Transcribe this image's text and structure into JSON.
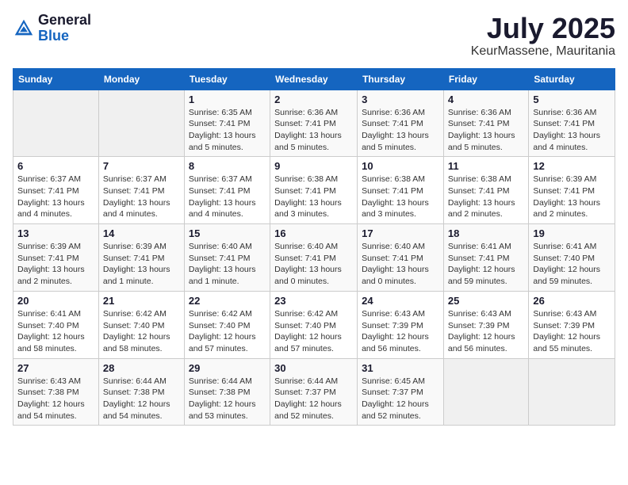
{
  "logo": {
    "general": "General",
    "blue": "Blue"
  },
  "header": {
    "month": "July 2025",
    "location": "KeurMassene, Mauritania"
  },
  "weekdays": [
    "Sunday",
    "Monday",
    "Tuesday",
    "Wednesday",
    "Thursday",
    "Friday",
    "Saturday"
  ],
  "weeks": [
    [
      {
        "day": "",
        "sunrise": "",
        "sunset": "",
        "daylight": ""
      },
      {
        "day": "",
        "sunrise": "",
        "sunset": "",
        "daylight": ""
      },
      {
        "day": "1",
        "sunrise": "Sunrise: 6:35 AM",
        "sunset": "Sunset: 7:41 PM",
        "daylight": "Daylight: 13 hours and 5 minutes."
      },
      {
        "day": "2",
        "sunrise": "Sunrise: 6:36 AM",
        "sunset": "Sunset: 7:41 PM",
        "daylight": "Daylight: 13 hours and 5 minutes."
      },
      {
        "day": "3",
        "sunrise": "Sunrise: 6:36 AM",
        "sunset": "Sunset: 7:41 PM",
        "daylight": "Daylight: 13 hours and 5 minutes."
      },
      {
        "day": "4",
        "sunrise": "Sunrise: 6:36 AM",
        "sunset": "Sunset: 7:41 PM",
        "daylight": "Daylight: 13 hours and 5 minutes."
      },
      {
        "day": "5",
        "sunrise": "Sunrise: 6:36 AM",
        "sunset": "Sunset: 7:41 PM",
        "daylight": "Daylight: 13 hours and 4 minutes."
      }
    ],
    [
      {
        "day": "6",
        "sunrise": "Sunrise: 6:37 AM",
        "sunset": "Sunset: 7:41 PM",
        "daylight": "Daylight: 13 hours and 4 minutes."
      },
      {
        "day": "7",
        "sunrise": "Sunrise: 6:37 AM",
        "sunset": "Sunset: 7:41 PM",
        "daylight": "Daylight: 13 hours and 4 minutes."
      },
      {
        "day": "8",
        "sunrise": "Sunrise: 6:37 AM",
        "sunset": "Sunset: 7:41 PM",
        "daylight": "Daylight: 13 hours and 4 minutes."
      },
      {
        "day": "9",
        "sunrise": "Sunrise: 6:38 AM",
        "sunset": "Sunset: 7:41 PM",
        "daylight": "Daylight: 13 hours and 3 minutes."
      },
      {
        "day": "10",
        "sunrise": "Sunrise: 6:38 AM",
        "sunset": "Sunset: 7:41 PM",
        "daylight": "Daylight: 13 hours and 3 minutes."
      },
      {
        "day": "11",
        "sunrise": "Sunrise: 6:38 AM",
        "sunset": "Sunset: 7:41 PM",
        "daylight": "Daylight: 13 hours and 2 minutes."
      },
      {
        "day": "12",
        "sunrise": "Sunrise: 6:39 AM",
        "sunset": "Sunset: 7:41 PM",
        "daylight": "Daylight: 13 hours and 2 minutes."
      }
    ],
    [
      {
        "day": "13",
        "sunrise": "Sunrise: 6:39 AM",
        "sunset": "Sunset: 7:41 PM",
        "daylight": "Daylight: 13 hours and 2 minutes."
      },
      {
        "day": "14",
        "sunrise": "Sunrise: 6:39 AM",
        "sunset": "Sunset: 7:41 PM",
        "daylight": "Daylight: 13 hours and 1 minute."
      },
      {
        "day": "15",
        "sunrise": "Sunrise: 6:40 AM",
        "sunset": "Sunset: 7:41 PM",
        "daylight": "Daylight: 13 hours and 1 minute."
      },
      {
        "day": "16",
        "sunrise": "Sunrise: 6:40 AM",
        "sunset": "Sunset: 7:41 PM",
        "daylight": "Daylight: 13 hours and 0 minutes."
      },
      {
        "day": "17",
        "sunrise": "Sunrise: 6:40 AM",
        "sunset": "Sunset: 7:41 PM",
        "daylight": "Daylight: 13 hours and 0 minutes."
      },
      {
        "day": "18",
        "sunrise": "Sunrise: 6:41 AM",
        "sunset": "Sunset: 7:41 PM",
        "daylight": "Daylight: 12 hours and 59 minutes."
      },
      {
        "day": "19",
        "sunrise": "Sunrise: 6:41 AM",
        "sunset": "Sunset: 7:40 PM",
        "daylight": "Daylight: 12 hours and 59 minutes."
      }
    ],
    [
      {
        "day": "20",
        "sunrise": "Sunrise: 6:41 AM",
        "sunset": "Sunset: 7:40 PM",
        "daylight": "Daylight: 12 hours and 58 minutes."
      },
      {
        "day": "21",
        "sunrise": "Sunrise: 6:42 AM",
        "sunset": "Sunset: 7:40 PM",
        "daylight": "Daylight: 12 hours and 58 minutes."
      },
      {
        "day": "22",
        "sunrise": "Sunrise: 6:42 AM",
        "sunset": "Sunset: 7:40 PM",
        "daylight": "Daylight: 12 hours and 57 minutes."
      },
      {
        "day": "23",
        "sunrise": "Sunrise: 6:42 AM",
        "sunset": "Sunset: 7:40 PM",
        "daylight": "Daylight: 12 hours and 57 minutes."
      },
      {
        "day": "24",
        "sunrise": "Sunrise: 6:43 AM",
        "sunset": "Sunset: 7:39 PM",
        "daylight": "Daylight: 12 hours and 56 minutes."
      },
      {
        "day": "25",
        "sunrise": "Sunrise: 6:43 AM",
        "sunset": "Sunset: 7:39 PM",
        "daylight": "Daylight: 12 hours and 56 minutes."
      },
      {
        "day": "26",
        "sunrise": "Sunrise: 6:43 AM",
        "sunset": "Sunset: 7:39 PM",
        "daylight": "Daylight: 12 hours and 55 minutes."
      }
    ],
    [
      {
        "day": "27",
        "sunrise": "Sunrise: 6:43 AM",
        "sunset": "Sunset: 7:38 PM",
        "daylight": "Daylight: 12 hours and 54 minutes."
      },
      {
        "day": "28",
        "sunrise": "Sunrise: 6:44 AM",
        "sunset": "Sunset: 7:38 PM",
        "daylight": "Daylight: 12 hours and 54 minutes."
      },
      {
        "day": "29",
        "sunrise": "Sunrise: 6:44 AM",
        "sunset": "Sunset: 7:38 PM",
        "daylight": "Daylight: 12 hours and 53 minutes."
      },
      {
        "day": "30",
        "sunrise": "Sunrise: 6:44 AM",
        "sunset": "Sunset: 7:37 PM",
        "daylight": "Daylight: 12 hours and 52 minutes."
      },
      {
        "day": "31",
        "sunrise": "Sunrise: 6:45 AM",
        "sunset": "Sunset: 7:37 PM",
        "daylight": "Daylight: 12 hours and 52 minutes."
      },
      {
        "day": "",
        "sunrise": "",
        "sunset": "",
        "daylight": ""
      },
      {
        "day": "",
        "sunrise": "",
        "sunset": "",
        "daylight": ""
      }
    ]
  ]
}
